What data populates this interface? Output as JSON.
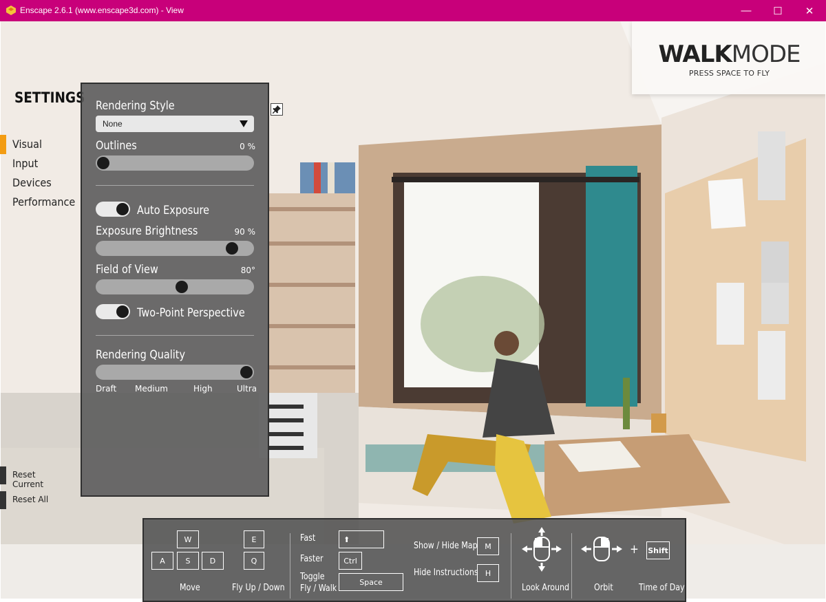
{
  "window": {
    "title": "Enscape 2.6.1 (www.enscape3d.com) - View",
    "minimize_glyph": "—",
    "maximize_glyph": "☐",
    "close_glyph": "✕"
  },
  "mode": {
    "title_bold": "WALK",
    "title_light": "MODE",
    "subtitle": "PRESS SPACE TO FLY"
  },
  "nav": {
    "heading": "SETTINGS",
    "items": [
      "Visual",
      "Input",
      "Devices",
      "Performance"
    ],
    "active": "Visual",
    "accent_color": "#f39c12",
    "reset_current": "Reset Current",
    "reset_all": "Reset All"
  },
  "settings": {
    "rendering_style_label": "Rendering Style",
    "rendering_style_value": "None",
    "outlines_label": "Outlines",
    "outlines_value": "0 %",
    "outlines_level": 0,
    "auto_exposure_label": "Auto Exposure",
    "auto_exposure_on": true,
    "exposure_brightness_label": "Exposure Brightness",
    "exposure_brightness_value": "90 %",
    "exposure_brightness_level": 0.9,
    "fov_label": "Field of View",
    "fov_value": "80°",
    "fov_level": 0.55,
    "two_point_label": "Two-Point Perspective",
    "two_point_on": true,
    "rendering_quality_label": "Rendering Quality",
    "quality_levels": [
      "Draft",
      "Medium",
      "High",
      "Ultra"
    ],
    "quality_selected": "Ultra"
  },
  "help": {
    "keys": {
      "w": "W",
      "a": "A",
      "s": "S",
      "d": "D",
      "e": "E",
      "q": "Q",
      "ctrl": "Ctrl",
      "space": "Space",
      "m": "M",
      "h": "H",
      "shift": "Shift",
      "up_arrow": "⬆"
    },
    "move": "Move",
    "fly_up_down": "Fly Up / Down",
    "fast": "Fast",
    "faster": "Faster",
    "toggle_line1": "Toggle",
    "toggle_line2": "Fly / Walk",
    "show_hide_map": "Show / Hide Map",
    "hide_instructions": "Hide Instructions",
    "look_around": "Look Around",
    "orbit": "Orbit",
    "plus": "+",
    "time_of_day": "Time of Day"
  }
}
